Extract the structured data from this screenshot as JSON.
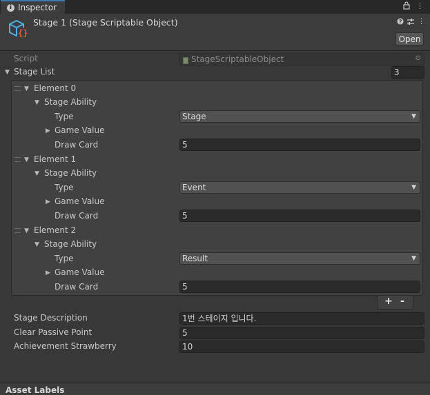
{
  "tab": {
    "label": "Inspector",
    "icon": "info-icon"
  },
  "header": {
    "title": "Stage 1 (Stage Scriptable Object)",
    "open_label": "Open"
  },
  "script": {
    "label": "Script",
    "value": "StageScriptableObject"
  },
  "stage_list": {
    "label": "Stage List",
    "size": "3",
    "elements": [
      {
        "label": "Element 0",
        "ability_label": "Stage Ability",
        "type_label": "Type",
        "type_value": "Stage",
        "game_value_label": "Game Value",
        "draw_card_label": "Draw Card",
        "draw_card_value": "5"
      },
      {
        "label": "Element 1",
        "ability_label": "Stage Ability",
        "type_label": "Type",
        "type_value": "Event",
        "game_value_label": "Game Value",
        "draw_card_label": "Draw Card",
        "draw_card_value": "5"
      },
      {
        "label": "Element 2",
        "ability_label": "Stage Ability",
        "type_label": "Type",
        "type_value": "Result",
        "game_value_label": "Game Value",
        "draw_card_label": "Draw Card",
        "draw_card_value": "5"
      }
    ],
    "add_label": "+",
    "remove_label": "-"
  },
  "fields": {
    "stage_description": {
      "label": "Stage Description",
      "value": "1번 스테이지 입니다."
    },
    "clear_passive_point": {
      "label": "Clear Passive Point",
      "value": "5"
    },
    "achievement_strawberry": {
      "label": "Achievement Strawberry",
      "value": "10"
    }
  },
  "asset_labels": "Asset Labels",
  "colors": {
    "tab_accent": "#3a79bb",
    "object_icon": "#4fb0e8",
    "object_icon_braces": "#e85a3c"
  }
}
